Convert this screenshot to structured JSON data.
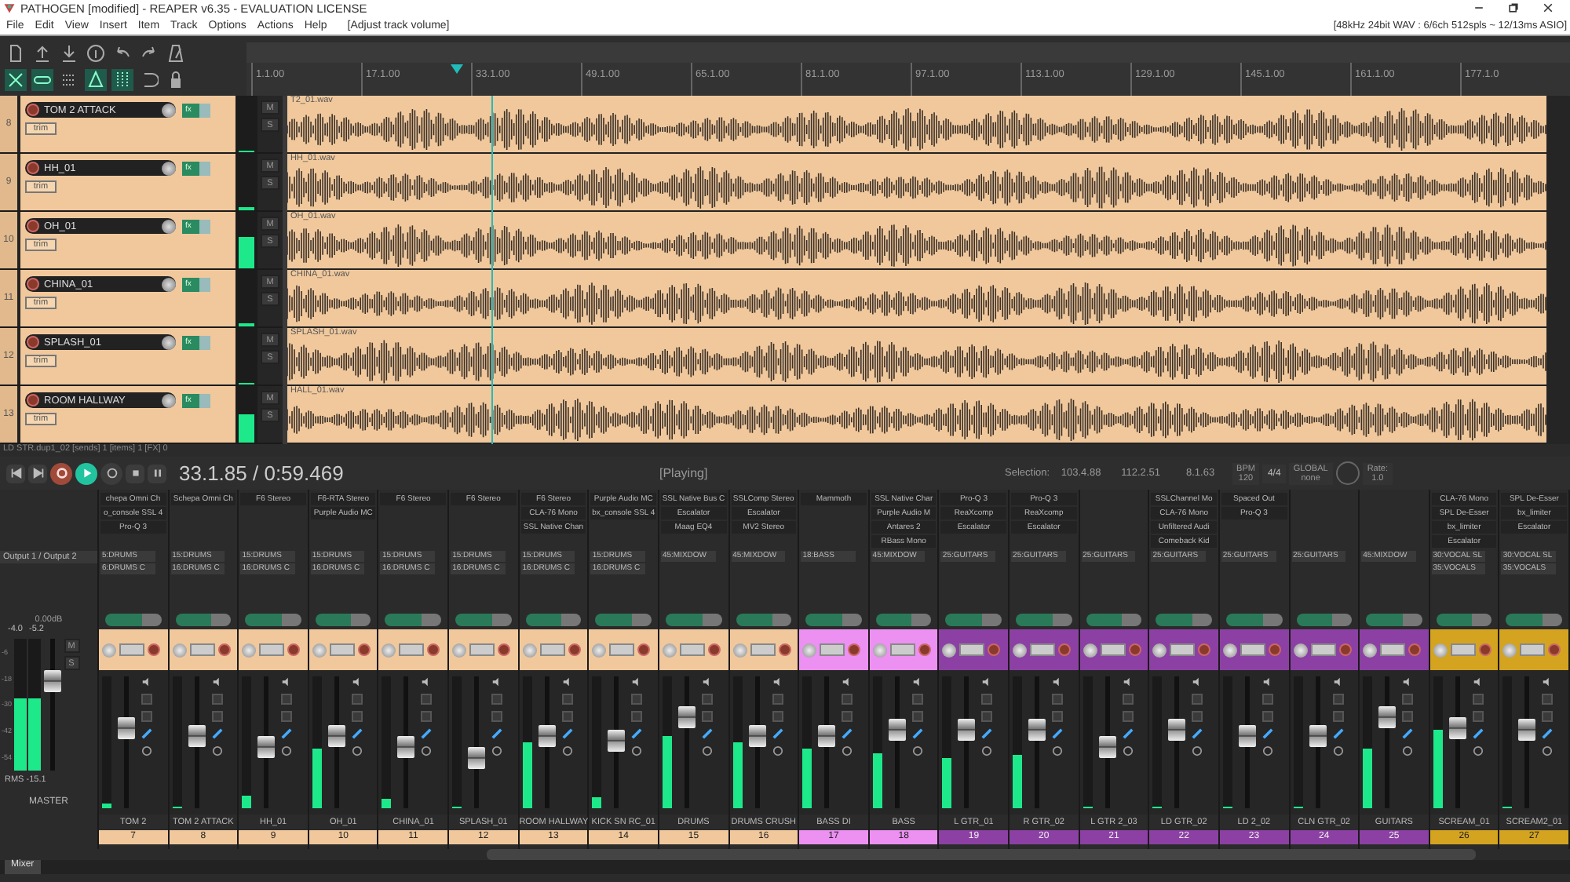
{
  "window": {
    "title": "PATHOGEN [modified] - REAPER v6.35 - EVALUATION LICENSE"
  },
  "menu": [
    "File",
    "Edit",
    "View",
    "Insert",
    "Item",
    "Track",
    "Options",
    "Actions",
    "Help"
  ],
  "action_hint": "[Adjust track volume]",
  "audio_status": "[48kHz 24bit WAV : 6/6ch 512spls ~ 12/13ms ASIO]",
  "ruler": [
    "1.1.00",
    "17.1.00",
    "33.1.00",
    "49.1.00",
    "65.1.00",
    "81.1.00",
    "97.1.00",
    "113.1.00",
    "129.1.00",
    "145.1.00",
    "161.1.00",
    "177.1.0"
  ],
  "tracks": [
    {
      "number": "8",
      "name": "TOM 2 ATTACK",
      "fx": "fx",
      "trim": "trim",
      "mute": "M",
      "solo": "S",
      "item": "T2_01.wav",
      "meter": {
        "level": 0
      }
    },
    {
      "number": "9",
      "name": "HH_01",
      "fx": "fx",
      "trim": "trim",
      "mute": "M",
      "solo": "S",
      "item": "HH_01.wav",
      "meter": {
        "level": 0.05
      }
    },
    {
      "number": "10",
      "name": "OH_01",
      "fx": "fx",
      "trim": "trim",
      "mute": "M",
      "solo": "S",
      "item": "OH_01.wav",
      "meter": {
        "level": 0.55
      }
    },
    {
      "number": "11",
      "name": "CHINA_01",
      "fx": "fx",
      "trim": "trim",
      "mute": "M",
      "solo": "S",
      "item": "CHINA_01.wav",
      "meter": {
        "level": 0.05
      }
    },
    {
      "number": "12",
      "name": "SPLASH_01",
      "fx": "fx",
      "trim": "trim",
      "mute": "M",
      "solo": "S",
      "item": "SPLASH_01.wav",
      "meter": {
        "level": 0
      }
    },
    {
      "number": "13",
      "name": "ROOM HALLWAY",
      "fx": "fx",
      "trim": "trim",
      "mute": "M",
      "solo": "S",
      "item": "HALL_01.wav",
      "meter": {
        "level": 0.5
      }
    }
  ],
  "status_line": "LD STR.dup1_02 [sends] 1 [items] 1 [FX] 0",
  "transport": {
    "position": "33.1.85 / 0:59.469",
    "state": "[Playing]",
    "playing": true,
    "selection_label": "Selection:",
    "selection": [
      "103.4.88",
      "112.2.51",
      "8.1.63"
    ],
    "bpm_label": "BPM",
    "bpm": "120",
    "signature": "4/4",
    "global_label": "GLOBAL",
    "global_value": "none",
    "rate_label": "Rate:",
    "rate": "1.0"
  },
  "master": {
    "output": "Output 1 / Output 2",
    "volume": "0.00dB",
    "peaks": [
      "-4.0",
      "-5.2"
    ],
    "mute": "M",
    "solo": "S",
    "scale": [
      "-6",
      "-18",
      "-30",
      "-42",
      "-54"
    ],
    "meter": {
      "level": 0.55
    },
    "fader": {
      "level": 0.7
    },
    "rms": "RMS -15.1",
    "name": "MASTER"
  },
  "mixer_strips": [
    {
      "number": "7",
      "name": "TOM 2",
      "color": "#f0c89c",
      "fx": [
        "chepa Omni Ch",
        "o_console SSL 4",
        "Pro-Q 3"
      ],
      "sends": [
        "5:DRUMS",
        "6:DRUMS C"
      ],
      "fader": {
        "level": 0.62
      },
      "meter": {
        "level": 0.03
      }
    },
    {
      "number": "8",
      "name": "TOM 2 ATTACK",
      "color": "#f0c89c",
      "fx": [
        "Schepa Omni Ch"
      ],
      "sends": [
        "15:DRUMS",
        "16:DRUMS C"
      ],
      "fader": {
        "level": 0.55
      },
      "meter": {
        "level": 0
      }
    },
    {
      "number": "9",
      "name": "HH_01",
      "color": "#f0c89c",
      "fx": [
        "F6 Stereo"
      ],
      "sends": [
        "15:DRUMS",
        "16:DRUMS C"
      ],
      "fader": {
        "level": 0.45
      },
      "meter": {
        "level": 0.1
      }
    },
    {
      "number": "10",
      "name": "OH_01",
      "color": "#f0c89c",
      "fx": [
        "F6-RTA Stereo",
        "Purple Audio MC"
      ],
      "sends": [
        "15:DRUMS",
        "16:DRUMS C"
      ],
      "fader": {
        "level": 0.55
      },
      "meter": {
        "level": 0.45
      }
    },
    {
      "number": "11",
      "name": "CHINA_01",
      "color": "#f0c89c",
      "fx": [
        "F6 Stereo"
      ],
      "sends": [
        "15:DRUMS",
        "16:DRUMS C"
      ],
      "fader": {
        "level": 0.45
      },
      "meter": {
        "level": 0.07
      }
    },
    {
      "number": "12",
      "name": "SPLASH_01",
      "color": "#f0c89c",
      "fx": [
        "F6 Stereo"
      ],
      "sends": [
        "15:DRUMS",
        "16:DRUMS C"
      ],
      "fader": {
        "level": 0.35
      },
      "meter": {
        "level": 0
      }
    },
    {
      "number": "13",
      "name": "ROOM HALLWAY",
      "color": "#f0c89c",
      "fx": [
        "F6 Stereo",
        "CLA-76 Mono",
        "SSL Native Chan"
      ],
      "sends": [
        "15:DRUMS",
        "16:DRUMS C"
      ],
      "fader": {
        "level": 0.55
      },
      "meter": {
        "level": 0.5
      }
    },
    {
      "number": "14",
      "name": "KICK SN RC_01",
      "color": "#f0c89c",
      "fx": [
        "Purple Audio MC",
        "bx_console SSL 4"
      ],
      "sends": [
        "15:DRUMS",
        "16:DRUMS C"
      ],
      "fader": {
        "level": 0.5
      },
      "meter": {
        "level": 0.08
      }
    },
    {
      "number": "15",
      "name": "DRUMS",
      "color": "#f0c89c",
      "fx": [
        "SSL Native Bus C",
        "Escalator",
        "Maag EQ4"
      ],
      "sends": [
        "45:MIXDOW"
      ],
      "fader": {
        "level": 0.72
      },
      "meter": {
        "level": 0.55
      }
    },
    {
      "number": "16",
      "name": "DRUMS CRUSH",
      "color": "#f0c89c",
      "fx": [
        "SSLComp Stereo",
        "Escalator",
        "MV2 Stereo"
      ],
      "sends": [
        "45:MIXDOW"
      ],
      "fader": {
        "level": 0.55
      },
      "meter": {
        "level": 0.5
      }
    },
    {
      "number": "17",
      "name": "BASS DI",
      "color": "#ec90f2",
      "fx": [
        "Mammoth"
      ],
      "sends": [
        "18:BASS"
      ],
      "fader": {
        "level": 0.55
      },
      "meter": {
        "level": 0.45
      }
    },
    {
      "number": "18",
      "name": "BASS",
      "color": "#ec90f2",
      "fx": [
        "SSL Native Char",
        "Purple Audio M",
        "Antares 2",
        "RBass Mono"
      ],
      "sends": [
        "45:MIXDOW"
      ],
      "fader": {
        "level": 0.6
      },
      "meter": {
        "level": 0.42
      }
    },
    {
      "number": "19",
      "name": "L GTR_01",
      "color": "#8c40a4",
      "fx": [
        "Pro-Q 3",
        "ReaXcomp",
        "Escalator"
      ],
      "sends": [
        "25:GUITARS"
      ],
      "fader": {
        "level": 0.6
      },
      "meter": {
        "level": 0.38
      }
    },
    {
      "number": "20",
      "name": "R GTR_02",
      "color": "#8c40a4",
      "fx": [
        "Pro-Q 3",
        "ReaXcomp",
        "Escalator"
      ],
      "sends": [
        "25:GUITARS"
      ],
      "fader": {
        "level": 0.6
      },
      "meter": {
        "level": 0.4
      }
    },
    {
      "number": "21",
      "name": "L GTR 2_03",
      "color": "#8c40a4",
      "sends": [
        "25:GUITARS"
      ],
      "fader": {
        "level": 0.45
      },
      "meter": {
        "level": 0
      }
    },
    {
      "number": "22",
      "name": "LD GTR_02",
      "color": "#8c40a4",
      "fx": [
        "SSLChannel Mo",
        "CLA-76 Mono",
        "Unfiltered Audi",
        "Comeback Kid"
      ],
      "sends": [
        "25:GUITARS"
      ],
      "fader": {
        "level": 0.6
      },
      "meter": {
        "level": 0
      }
    },
    {
      "number": "23",
      "name": "LD 2_02",
      "color": "#8c40a4",
      "fx": [
        "Spaced Out",
        "Pro-Q 3"
      ],
      "sends": [
        "25:GUITARS"
      ],
      "fader": {
        "level": 0.55
      },
      "meter": {
        "level": 0
      }
    },
    {
      "number": "24",
      "name": "CLN GTR_02",
      "color": "#8c40a4",
      "sends": [
        "25:GUITARS"
      ],
      "fader": {
        "level": 0.55
      },
      "meter": {
        "level": 0
      }
    },
    {
      "number": "25",
      "name": "GUITARS",
      "color": "#8c40a4",
      "sends": [
        "45:MIXDOW"
      ],
      "fader": {
        "level": 0.72
      },
      "meter": {
        "level": 0.45
      }
    },
    {
      "number": "26",
      "name": "SCREAM_01",
      "color": "#d4a420",
      "fx": [
        "CLA-76 Mono",
        "SPL De-Esser",
        "bx_limiter",
        "Escalator"
      ],
      "sends": [
        "30:VOCAL SL",
        "35:VOCALS"
      ],
      "fader": {
        "level": 0.62
      },
      "meter": {
        "level": 0.6
      }
    },
    {
      "number": "27",
      "name": "SCREAM2_01",
      "color": "#d4a420",
      "fx": [
        "SPL De-Esser",
        "bx_limiter",
        "Escalator"
      ],
      "sends": [
        "30:VOCAL SL",
        "35:VOCALS"
      ],
      "fader": {
        "level": 0.6
      },
      "meter": {
        "level": 0
      }
    }
  ],
  "tabs": [
    {
      "label": "Mixer",
      "selected": true
    }
  ]
}
